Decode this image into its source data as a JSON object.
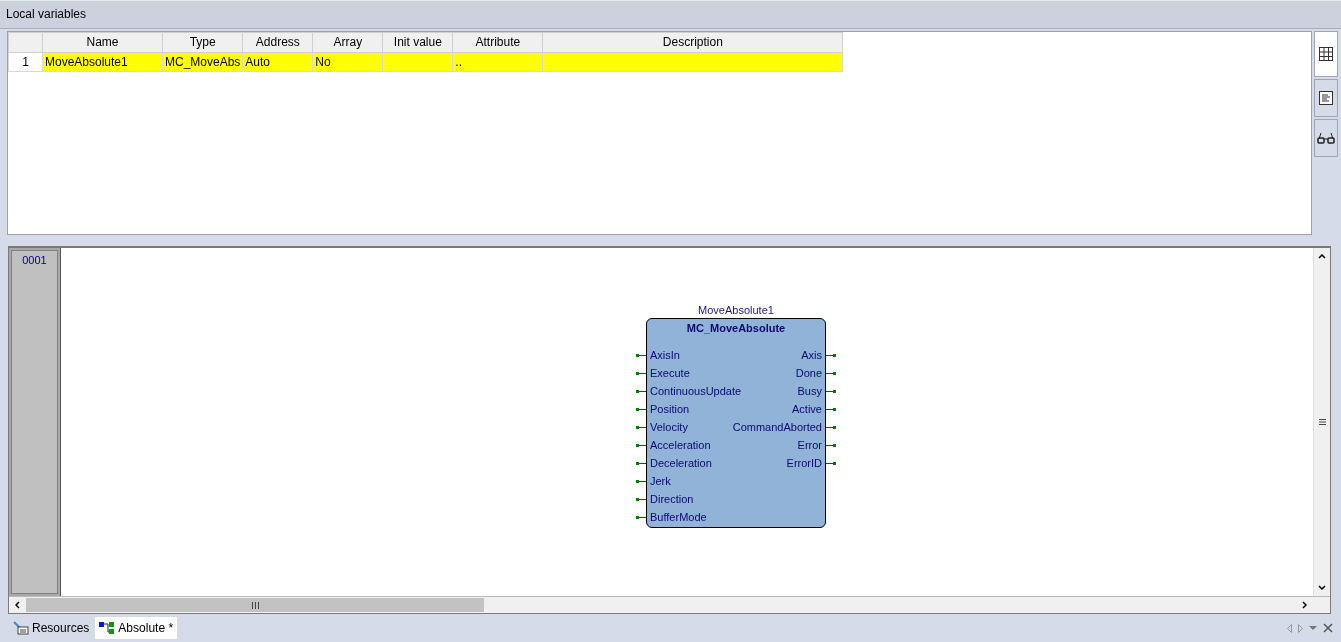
{
  "panel_title": "Local variables",
  "table": {
    "columns": [
      "Name",
      "Type",
      "Address",
      "Array",
      "Init value",
      "Attribute",
      "Description"
    ],
    "rows": [
      {
        "number": "1",
        "selected": true,
        "cells": [
          "MoveAbsolute1",
          "MC_MoveAbs",
          "Auto",
          "No",
          "",
          "..",
          ""
        ]
      }
    ]
  },
  "side_tabs": [
    {
      "kind": "grid",
      "selected": true
    },
    {
      "kind": "document",
      "selected": false
    },
    {
      "kind": "glasses",
      "selected": false
    }
  ],
  "editor": {
    "line_number": "0001",
    "block": {
      "instance": "MoveAbsolute1",
      "type": "MC_MoveAbsolute",
      "inputs": [
        "AxisIn",
        "Execute",
        "ContinuousUpdate",
        "Position",
        "Velocity",
        "Acceleration",
        "Deceleration",
        "Jerk",
        "Direction",
        "BufferMode"
      ],
      "outputs": [
        "Axis",
        "Done",
        "Busy",
        "Active",
        "CommandAborted",
        "Error",
        "ErrorID"
      ]
    }
  },
  "bottom_tabs": [
    {
      "label": "Resources",
      "kind": "resources",
      "selected": false
    },
    {
      "label": "Absolute *",
      "kind": "diagram",
      "selected": true
    }
  ]
}
